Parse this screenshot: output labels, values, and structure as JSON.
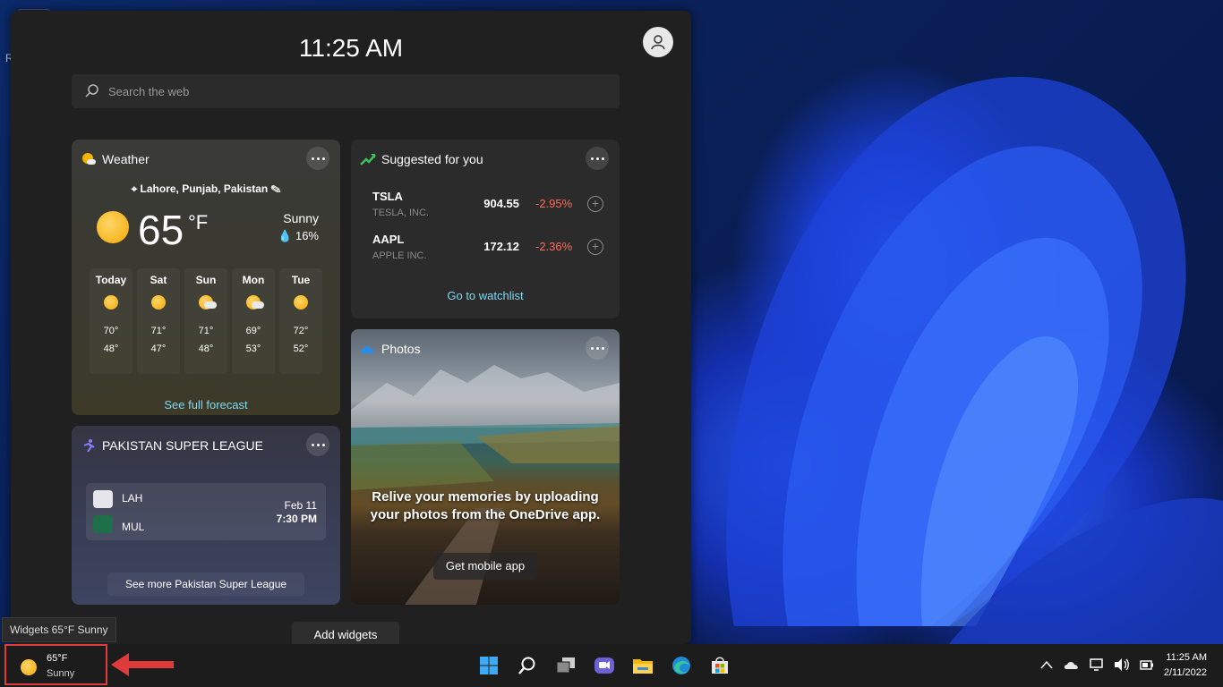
{
  "desktop": {
    "edge_letter": "R"
  },
  "widgets_panel": {
    "clock": "11:25 AM",
    "search": {
      "placeholder": "Search the web"
    },
    "add_widgets_label": "Add widgets"
  },
  "weather": {
    "title": "Weather",
    "location": "Lahore, Punjab, Pakistan",
    "temp": "65",
    "unit": "°F",
    "condition": "Sunny",
    "precip": "16%",
    "forecast": [
      {
        "day": "Today",
        "icon": "sun-icon",
        "hi": "70°",
        "lo": "48°"
      },
      {
        "day": "Sat",
        "icon": "sun-icon",
        "hi": "71°",
        "lo": "47°"
      },
      {
        "day": "Sun",
        "icon": "partly-cloudy-icon",
        "hi": "71°",
        "lo": "48°"
      },
      {
        "day": "Mon",
        "icon": "partly-cloudy-icon",
        "hi": "69°",
        "lo": "53°"
      },
      {
        "day": "Tue",
        "icon": "sun-icon",
        "hi": "72°",
        "lo": "52°"
      }
    ],
    "link": "See full forecast"
  },
  "stocks": {
    "title": "Suggested for you",
    "rows": [
      {
        "ticker": "TSLA",
        "company": "TESLA, INC.",
        "price": "904.55",
        "change": "-2.95%"
      },
      {
        "ticker": "AAPL",
        "company": "APPLE INC.",
        "price": "172.12",
        "change": "-2.36%"
      }
    ],
    "link": "Go to watchlist",
    "change_color": "#ff6a5a"
  },
  "psl": {
    "title": "PAKISTAN SUPER LEAGUE",
    "team1": "LAH",
    "team2": "MUL",
    "date": "Feb 11",
    "time": "7:30 PM",
    "link": "See more Pakistan Super League"
  },
  "photos": {
    "title": "Photos",
    "message": "Relive your memories by uploading your photos from the OneDrive app.",
    "button": "Get mobile app"
  },
  "tooltip": "Widgets 65°F Sunny",
  "taskbar": {
    "weather_temp": "65°F",
    "weather_cond": "Sunny",
    "apps": [
      "start-icon",
      "search-icon",
      "task-view-icon",
      "chat-icon",
      "file-explorer-icon",
      "edge-icon",
      "store-icon"
    ],
    "time": "11:25 AM",
    "date": "2/11/2022",
    "highlight_color": "#e03a3a"
  }
}
